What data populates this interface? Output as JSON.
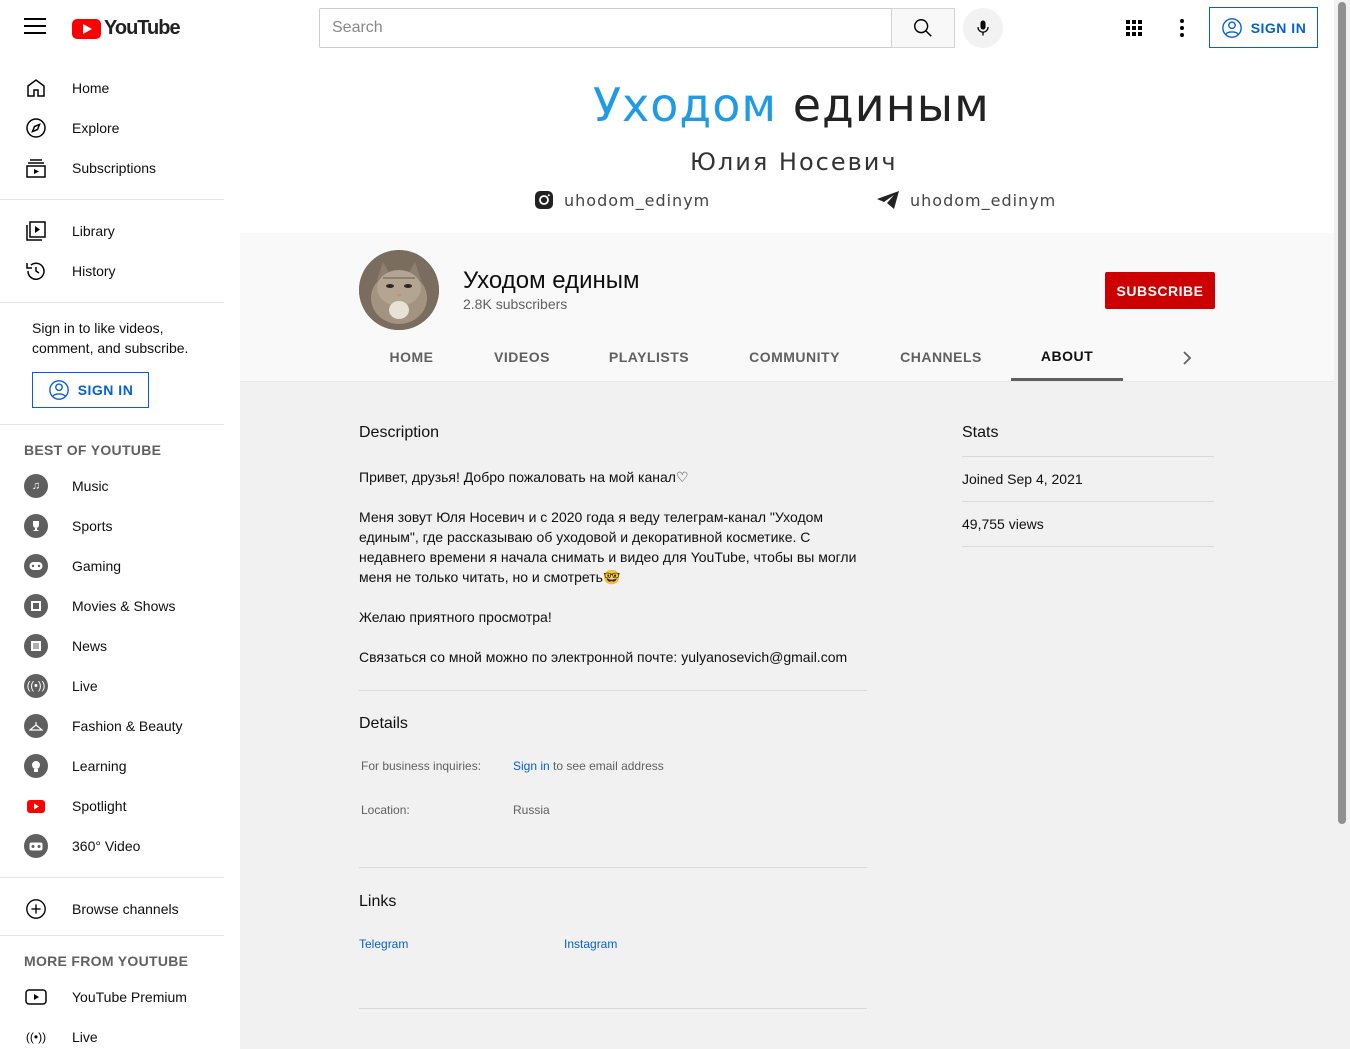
{
  "header": {
    "logo_text": "YouTube",
    "search_placeholder": "Search",
    "sign_in": "SIGN IN"
  },
  "sidebar": {
    "main": [
      {
        "label": "Home",
        "icon": "home-icon"
      },
      {
        "label": "Explore",
        "icon": "compass-icon"
      },
      {
        "label": "Subscriptions",
        "icon": "subscriptions-icon"
      }
    ],
    "library": [
      {
        "label": "Library",
        "icon": "library-icon"
      },
      {
        "label": "History",
        "icon": "history-icon"
      }
    ],
    "signin_prompt": "Sign in to like videos, comment, and subscribe.",
    "signin_button": "SIGN IN",
    "best_heading": "BEST OF YOUTUBE",
    "best": [
      {
        "label": "Music",
        "icon": "music-icon"
      },
      {
        "label": "Sports",
        "icon": "trophy-icon"
      },
      {
        "label": "Gaming",
        "icon": "gamepad-icon"
      },
      {
        "label": "Movies & Shows",
        "icon": "film-icon"
      },
      {
        "label": "News",
        "icon": "news-icon"
      },
      {
        "label": "Live",
        "icon": "live-icon"
      },
      {
        "label": "Fashion & Beauty",
        "icon": "hanger-icon"
      },
      {
        "label": "Learning",
        "icon": "lightbulb-icon"
      },
      {
        "label": "Spotlight",
        "icon": "youtube-logo-icon"
      },
      {
        "label": "360° Video",
        "icon": "vr-icon"
      }
    ],
    "browse_channels": "Browse channels",
    "more_heading": "MORE FROM YOUTUBE",
    "more": [
      {
        "label": "YouTube Premium",
        "icon": "premium-icon"
      },
      {
        "label": "Live",
        "icon": "broadcast-icon"
      }
    ]
  },
  "banner": {
    "title_part1": "Уходом",
    "title_part2": "единым",
    "subtitle": "Юлия Носевич",
    "instagram": "uhodom_edinym",
    "telegram": "uhodom_edinym"
  },
  "channel": {
    "name": "Уходом единым",
    "subscribers": "2.8K subscribers",
    "subscribe": "SUBSCRIBE",
    "tabs": [
      "HOME",
      "VIDEOS",
      "PLAYLISTS",
      "COMMUNITY",
      "CHANNELS",
      "ABOUT"
    ],
    "active_tab": "ABOUT"
  },
  "about": {
    "description_title": "Description",
    "description": [
      "Привет, друзья! Добро пожаловать на мой канал♡",
      "Меня зовут Юля Носевич и с 2020 года я веду телеграм-канал \"Уходом единым\", где рассказываю об уходовой и декоративной косметике. С недавнего времени я начала снимать и видео для YouTube, чтобы вы могли меня не только читать, но и смотреть🤓",
      "Желаю приятного просмотра!",
      "Связаться со мной можно по электронной почте: yulyanosevich@gmail.com"
    ],
    "details_title": "Details",
    "business_label": "For business inquiries:",
    "business_link": "Sign in",
    "business_suffix": "to see email address",
    "location_label": "Location:",
    "location_value": "Russia",
    "links_title": "Links",
    "links": [
      "Telegram",
      "Instagram"
    ],
    "stats_title": "Stats",
    "joined": "Joined Sep 4, 2021",
    "views": "49,755 views"
  },
  "colors": {
    "accent_blue": "#065fd4",
    "subscribe_red": "#cc0000",
    "banner_blue": "#1f9be6"
  }
}
